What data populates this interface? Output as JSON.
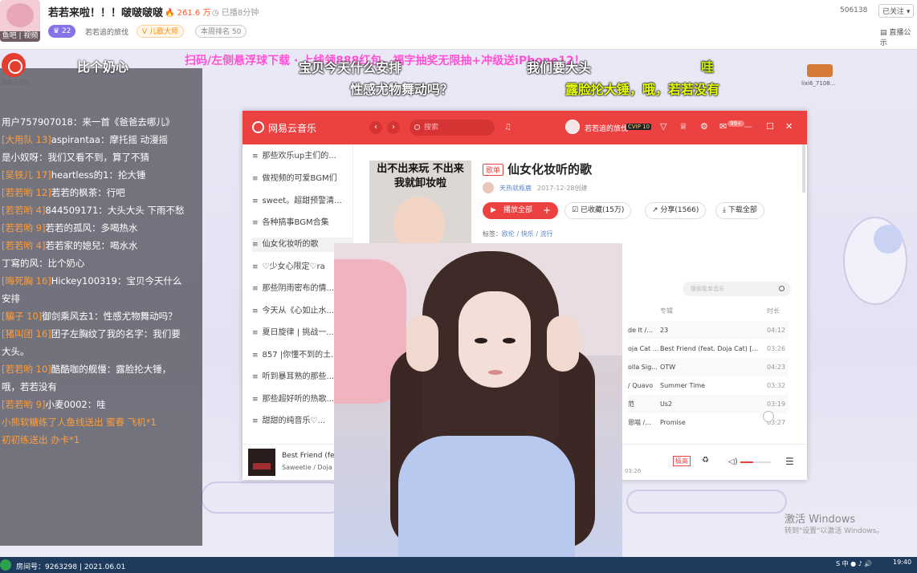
{
  "header": {
    "logo_caption": "鱼吧 | 视频",
    "title": "若若来啦！！！啵啵啵啵",
    "hot": "261.6 万",
    "ago": "已播8分钟",
    "fan_level": "22",
    "fan_name": "若若追的旅伐",
    "category": "儿歌大师",
    "rank": "本周排名 50",
    "room_number": "506138",
    "follow": "已关注",
    "live_notice": "直播公示"
  },
  "overlay": {
    "wyy_caption": "网易云音乐",
    "bixin": "比个奶心",
    "scroll_banner": "扫码/左侧悬浮球下载  ·   上线领888红包，福字抽奖无限抽+冲级送iPhone12！",
    "danmu": [
      "宝贝今天什么安排",
      "性感尤物舞动吗？",
      "我们要大头",
      "哇",
      "露脸抡大锤，哦，若若没有"
    ],
    "doodle_caption": "lixi6_7108...",
    "windows_activate": "激活 Windows",
    "windows_activate_hint": "转到\"设置\"以激活 Windows。"
  },
  "chat": [
    {
      "prefix": "",
      "user": "用户757907018：",
      "text": "来一首《爸爸去哪儿》"
    },
    {
      "prefix": "[大用队 13]",
      "user": "aspirantaa：",
      "text": "摩托摇 动漫摇"
    },
    {
      "prefix": "",
      "user": "是小奴呀：",
      "text": "我们又看不到，算了不猜"
    },
    {
      "prefix": "[吴铁儿 17]",
      "user": "heartless的1：",
      "text": "抡大锤"
    },
    {
      "prefix": "[若若哟 12]",
      "user": "若若的枫茶：",
      "text": "行吧"
    },
    {
      "prefix": "[若若哟 4]",
      "user": "844509171：",
      "text": "大头大头 下雨不愁"
    },
    {
      "prefix": "[若若哟 9]",
      "user": "若若的孤风：",
      "text": "多喝热水"
    },
    {
      "prefix": "[若若哟 4]",
      "user": "若若家的媳兒：",
      "text": "喝水水"
    },
    {
      "prefix": "",
      "user": "丁寫的风：",
      "text": "比个奶心"
    },
    {
      "prefix": "[晦死胸 16]",
      "user": "Hickey100319：",
      "text": "宝贝今天什么"
    },
    {
      "prefix": "",
      "user": "",
      "text": "安排"
    },
    {
      "prefix": "[騙子 10]",
      "user": "御剑乘风去1：",
      "text": "性感尤物舞动吗？"
    },
    {
      "prefix": "[猪叫团 16]",
      "user": "团子左胸纹了我的名字：",
      "text": "我们要"
    },
    {
      "prefix": "",
      "user": "",
      "text": "大头。"
    },
    {
      "prefix": "[若若哟 10]",
      "user": "酷酷咖的舰慢：",
      "text": "露脸抡大锤，"
    },
    {
      "prefix": "",
      "user": "",
      "text": "哦，若若没有"
    },
    {
      "prefix": "[若若哟 9]",
      "user": "小麦0002：",
      "text": "哇"
    },
    {
      "prefix": "",
      "user": "小熊软糖练了人鱼线",
      "text": "送出 蜜春 飞机*1",
      "gift": true
    },
    {
      "prefix": "",
      "user": "初初练",
      "text": "送出 办卡*1",
      "gift": true
    }
  ],
  "netease": {
    "app_name": "网易云音乐",
    "search_placeholder": "搜索",
    "user": "若若追的旅伐",
    "vip": "CVIP 10",
    "msg_count": "99+",
    "sidebar": [
      "那些欢乐up主们的...",
      "做视频的可爱BGM们",
      "sweet。超甜预警清...",
      "各种搞事BGM合集",
      "仙女化妆听的歌",
      "♡少女心限定♡ra",
      "那些阴雨密布的情...",
      "今天从《心如止水...",
      "夏日旋律 | 挑战一...",
      "857 |你懂不到的土...",
      "听到暴耳熟的那些...",
      "那些超好听的热歌...",
      "甜甜的纯音乐♡..."
    ],
    "cover_text": "出不出来玩 不出来我就卸妆啦",
    "playlist_tag": "歌单",
    "playlist_title": "仙女化妆听的歌",
    "creator": "天热就瓶鹿",
    "created": "2017-12-28创建",
    "play_all": "播放全部",
    "play_plus": "+",
    "collected": "已收藏(15万)",
    "share": "分享(1566)",
    "download": "下载全部",
    "tags_label": "标签：",
    "tags": "欧伦 / 快乐 / 流行",
    "inner_search": "搜索歌单音乐",
    "col_album": "专辑",
    "col_time": "时长",
    "rows": [
      {
        "a": "de It /...",
        "b": "23",
        "t": "04:12"
      },
      {
        "a": "oja Cat ...",
        "b": "Best Friend (feat. Doja Cat) [...",
        "t": "03:26"
      },
      {
        "a": "olla Sig...",
        "b": "OTW",
        "t": "04:23"
      },
      {
        "a": "/ Quavo",
        "b": "Summer Time",
        "t": "03:32"
      },
      {
        "a": "范",
        "b": "Us2",
        "t": "03:19"
      },
      {
        "a": "恩喵 /...",
        "b": "Promise",
        "t": "03:27"
      }
    ],
    "player_song": "Best Friend (fe",
    "player_artist": "Saweetie / Doja",
    "player_time": "03:26",
    "player_mode": "极高",
    "colors": {
      "red": "#ec4141"
    }
  },
  "taskbar": {
    "room": "房间号：9263298 | 2021.06.01",
    "tray": "S 中 ● ♪ 🔊",
    "clock": "19:40"
  }
}
